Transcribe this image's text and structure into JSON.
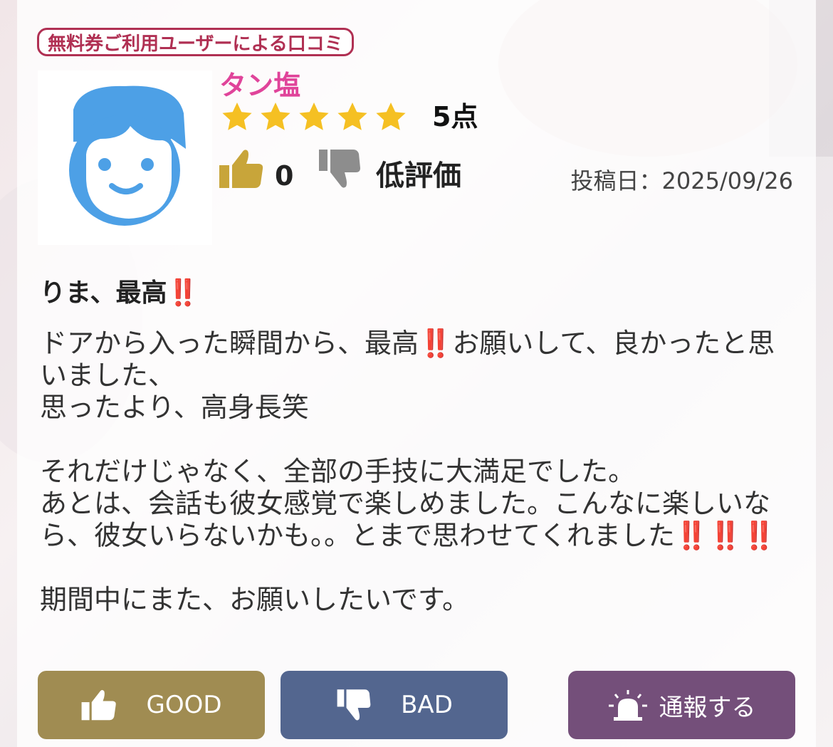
{
  "badge": {
    "label": "無料券ご利用ユーザーによる口コミ"
  },
  "reviewer": {
    "name": "タン塩",
    "avatar_icon": "boy-face-icon"
  },
  "rating": {
    "stars": 5,
    "max_stars": 5,
    "score_label": "5点",
    "star_color": "#f5c023"
  },
  "reactions": {
    "like_count": "0",
    "dislike_label": "低評価"
  },
  "post_date": "投稿日：2025/09/26",
  "review": {
    "title": "りま、最高",
    "title_emoji": "‼️",
    "line1a": "ドアから入った瞬間から、最高",
    "line1_emoji": "‼️",
    "line1b": "お願いして、良かったと思いました、",
    "line2": "思ったより、高身長笑",
    "line3": "それだけじゃなく、全部の手技に大満足でした。",
    "line4": "あとは、会話も彼女感覚で楽しめました。こんなに楽しいなら、彼女いらないかも。。とまで思わせてくれました",
    "line4_emoji": "‼️‼️‼️",
    "line5": "期間中にまた、お願いしたいです。"
  },
  "buttons": {
    "good": "GOOD",
    "bad": "BAD",
    "report": "通報する"
  },
  "colors": {
    "accent_pink": "#e0449a",
    "badge_red": "#b03053",
    "good_bg": "#a08c52",
    "bad_bg": "#53668f",
    "report_bg": "#744f7a"
  }
}
